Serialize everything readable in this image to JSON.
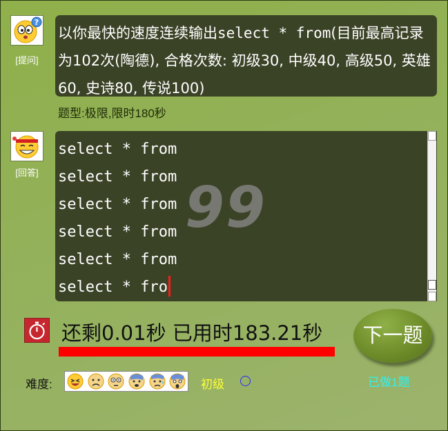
{
  "question": {
    "role_label": "[提问]",
    "text_part1": "以你最快的速度连续输出",
    "text_code": "select * from",
    "text_part2": "(目前最高记录为102次(陶德), 合格次数: 初级30, 中级40, 高级50, 英雄60, 史诗80, 传说100)",
    "type_line": "题型:极限,限时180秒"
  },
  "answer": {
    "role_label": "[回答]",
    "lines": [
      "select * from",
      "select * from",
      "select * from",
      "select * from",
      "select * from",
      "select * fro"
    ],
    "count": "99"
  },
  "timer": {
    "text": "还剩0.01秒 已用时183.21秒",
    "remaining_fraction": 0.9999
  },
  "next_button_label": "下一题",
  "done_count": "已做1题",
  "difficulty": {
    "label": "难度:",
    "level": "初级",
    "icons": [
      "laughing-face-icon",
      "worried-face-icon",
      "flushed-face-icon",
      "anxious-sweat-face-icon",
      "cold-sweat-face-icon",
      "screaming-face-icon"
    ]
  },
  "colors": {
    "background": "#93b15a",
    "bubble": "#3b4327",
    "progress": "#ff0000",
    "caret": "#ff1a1a",
    "level_text": "#ffff33",
    "done_text": "#2ef2f2",
    "timer_icon": "#c6262e"
  }
}
